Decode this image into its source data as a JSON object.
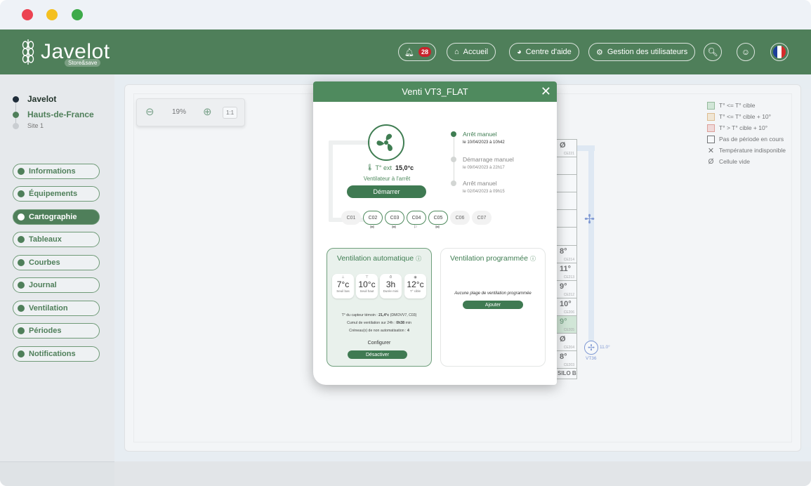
{
  "header": {
    "brand": "Javelot",
    "brand_sub": "Store&save",
    "notif_count": "28",
    "home": "Accueil",
    "help": "Centre d'aide",
    "users": "Gestion des utilisateurs"
  },
  "sidebar": {
    "tree": [
      {
        "label": "Javelot",
        "bold": true,
        "color": "#1f2d3a"
      },
      {
        "label": "Hauts-de-France",
        "bold": true,
        "color": "#4f7f5a"
      },
      {
        "label": "Site 1",
        "bold": false,
        "color": "#c9cdd1"
      }
    ],
    "items": [
      {
        "label": "Informations"
      },
      {
        "label": "Équipements"
      },
      {
        "label": "Cartographie",
        "active": true
      },
      {
        "label": "Tableaux"
      },
      {
        "label": "Courbes"
      },
      {
        "label": "Journal"
      },
      {
        "label": "Ventilation"
      },
      {
        "label": "Périodes"
      },
      {
        "label": "Notifications"
      }
    ]
  },
  "zoom": {
    "level": "19%",
    "reset": "1:1"
  },
  "legend": [
    {
      "label": "T° <= T° cible",
      "color": "#c7e3c9"
    },
    {
      "label": "T° <= T° cible + 10°",
      "color": "#f6e3c6"
    },
    {
      "label": "T° > T° cible + 10°",
      "color": "#f4d0cc"
    },
    {
      "label": "Pas de période en cours",
      "color": "#ffffff"
    },
    {
      "label": "Température indisponible"
    },
    {
      "label": "Cellule vide"
    }
  ],
  "map": {
    "cells": [
      {
        "val": "Ø",
        "sub": "CE221"
      },
      {
        "val": "",
        "sub": ""
      },
      {
        "val": "",
        "sub": ""
      },
      {
        "val": "",
        "sub": ""
      },
      {
        "val": "",
        "sub": ""
      },
      {
        "val": "",
        "sub": ""
      },
      {
        "val": "8°",
        "sub": "CE214"
      },
      {
        "val": "11°",
        "sub": "CE213"
      },
      {
        "val": "9°",
        "sub": "CE212"
      },
      {
        "val": "10°",
        "sub": "CE206"
      },
      {
        "val": "9°",
        "sub": "CE205",
        "green": true
      },
      {
        "val": "Ø",
        "sub": "CE204"
      },
      {
        "val": "8°",
        "sub": "CE203"
      }
    ],
    "silo": "SILO B",
    "vt_label": "VT36",
    "vt_temp": "11.0°"
  },
  "modal": {
    "title": "Venti VT3_FLAT",
    "temp_label": "T° ext",
    "temp_value": "15,0°c",
    "status": "Ventilateur à l'arrêt",
    "start": "Démarrer",
    "history": [
      {
        "title": "Arrêt manuel",
        "date": "le 10/04/2023 à 10h42",
        "active": true
      },
      {
        "title": "Démarrage manuel",
        "date": "le 09/04/2023 à 22h17",
        "active": false
      },
      {
        "title": "Arrêt manuel",
        "date": "le 02/04/2023 à 09h15",
        "active": false
      }
    ],
    "chips": [
      {
        "label": "C01",
        "on": false,
        "mark": ""
      },
      {
        "label": "C02",
        "on": true,
        "mark": "⋈"
      },
      {
        "label": "C03",
        "on": true,
        "mark": "⋈"
      },
      {
        "label": "C04",
        "on": true,
        "mark": "⚐"
      },
      {
        "label": "C05",
        "on": true,
        "mark": "⋈"
      },
      {
        "label": "C06",
        "on": false,
        "mark": ""
      },
      {
        "label": "C07",
        "on": false,
        "mark": ""
      }
    ],
    "auto": {
      "title": "Ventilation automatique",
      "tiles": [
        {
          "v": "7°c",
          "l": "Seuil bas",
          "i": "⊥"
        },
        {
          "v": "10°c",
          "l": "Seuil haut",
          "i": "⊤"
        },
        {
          "v": "3h",
          "l": "Durée mini",
          "i": "⏱"
        },
        {
          "v": "12°c",
          "l": "T° cible",
          "i": "◉"
        }
      ],
      "line1a": "T° du capteur témoin : ",
      "line1b": "21,4°c",
      "line1c": " (DMOVV7, C03)",
      "line2a": "Cumul de ventilation sur 24h : ",
      "line2b": "0h38",
      "line2c": " min",
      "line3a": "Créneau(x) de non automatisation : ",
      "line3b": "4",
      "configure": "Configurer",
      "deactivate": "Désactiver"
    },
    "prog": {
      "title": "Ventilation programmée",
      "empty": "Aucune plage de ventilation programmée",
      "add": "Ajouter"
    }
  },
  "colors": {
    "green": "#4f7f5a",
    "modal_green": "#4f8a5e",
    "auto_bg": "#e9f1ec"
  }
}
